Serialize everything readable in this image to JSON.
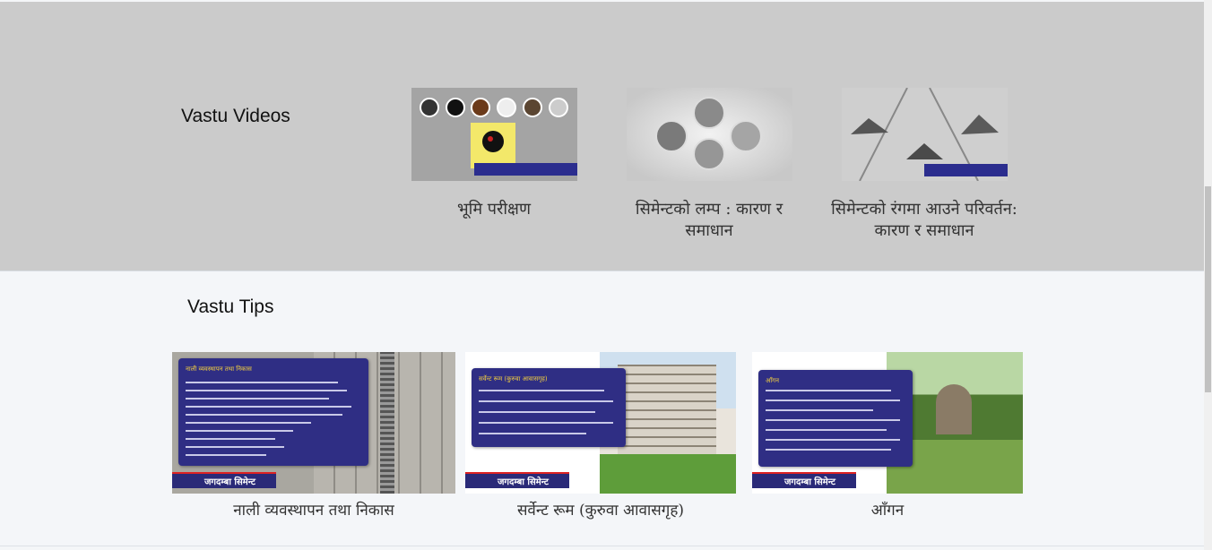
{
  "videos": {
    "heading": "Vastu Videos",
    "items": [
      {
        "title": "भूमि परीक्षण"
      },
      {
        "title": "सिमेन्टको लम्प : कारण र समाधान"
      },
      {
        "title": "सिमेन्टको रंगमा आउने परिवर्तन: कारण र समाधान"
      }
    ]
  },
  "tips": {
    "heading": "Vastu Tips",
    "items": [
      {
        "title": "नाली व्यवस्थापन तथा निकास",
        "panel_heading": "नाली व्यवस्थापन तथा निकास",
        "brand": "जगदम्बा सिमेन्ट"
      },
      {
        "title": "सर्वेन्ट रूम (कुरुवा आवासगृह)",
        "panel_heading": "सर्वेन्ट रूम (कुरुवा आवासगृह)",
        "brand": "जगदम्बा सिमेन्ट"
      },
      {
        "title": "आँगन",
        "panel_heading": "आँगन",
        "brand": "जगदम्बा सिमेन्ट"
      }
    ]
  }
}
